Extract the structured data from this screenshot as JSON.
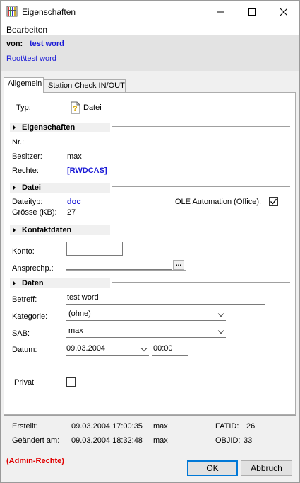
{
  "window": {
    "title": "Eigenschaften",
    "controls": {
      "minimize": "—",
      "maximize": "☐",
      "close": "✕"
    }
  },
  "menu": {
    "items": [
      "Bearbeiten"
    ]
  },
  "header": {
    "from_label": "von:",
    "from_value": "test word",
    "path": "Root\\test word"
  },
  "tabs": [
    {
      "label": "Allgemein",
      "active": true
    },
    {
      "label": "Station Check IN/OUT",
      "active": false
    }
  ],
  "general": {
    "type_label": "Typ:",
    "type_value": "Datei",
    "sections": {
      "eigenschaften": "Eigenschaften",
      "datei": "Datei",
      "kontaktdaten": "Kontaktdaten",
      "daten": "Daten"
    },
    "nr_label": "Nr.:",
    "owner_label": "Besitzer:",
    "owner_value": "max",
    "rights_label": "Rechte:",
    "rights_value": "[RWDCAS]",
    "filetype_label": "Dateityp:",
    "filetype_value": "doc",
    "size_label": "Grösse (KB):",
    "size_value": "27",
    "ole_label": "OLE Automation (Office):",
    "ole_checked": true,
    "account_label": "Konto:",
    "account_value": "",
    "contact_label": "Ansprechp.:",
    "contact_value": "",
    "contact_button": "...",
    "subject_label": "Betreff:",
    "subject_value": "test word",
    "category_label": "Kategorie:",
    "category_value": "(ohne)",
    "sab_label": "SAB:",
    "sab_value": "max",
    "date_label": "Datum:",
    "date_value": "09.03.2004",
    "time_value": "00:00",
    "private_label": "Privat",
    "private_checked": false
  },
  "footer": {
    "created_label": "Erstellt:",
    "created_date": "09.03.2004 17:00:35",
    "created_user": "max",
    "changed_label": "Geändert am:",
    "changed_date": "09.03.2004 18:32:48",
    "changed_user": "max",
    "fatid_label": "FATID:",
    "fatid_value": "26",
    "objid_label": "OBJID:",
    "objid_value": "33",
    "admin_note": "(Admin-Rechte)",
    "ok_label": "OK",
    "cancel_label": "Abbruch"
  },
  "colors": {
    "accent_blue": "#1a1ad6",
    "admin_red": "#e00000",
    "focus_border": "#0078d7"
  }
}
